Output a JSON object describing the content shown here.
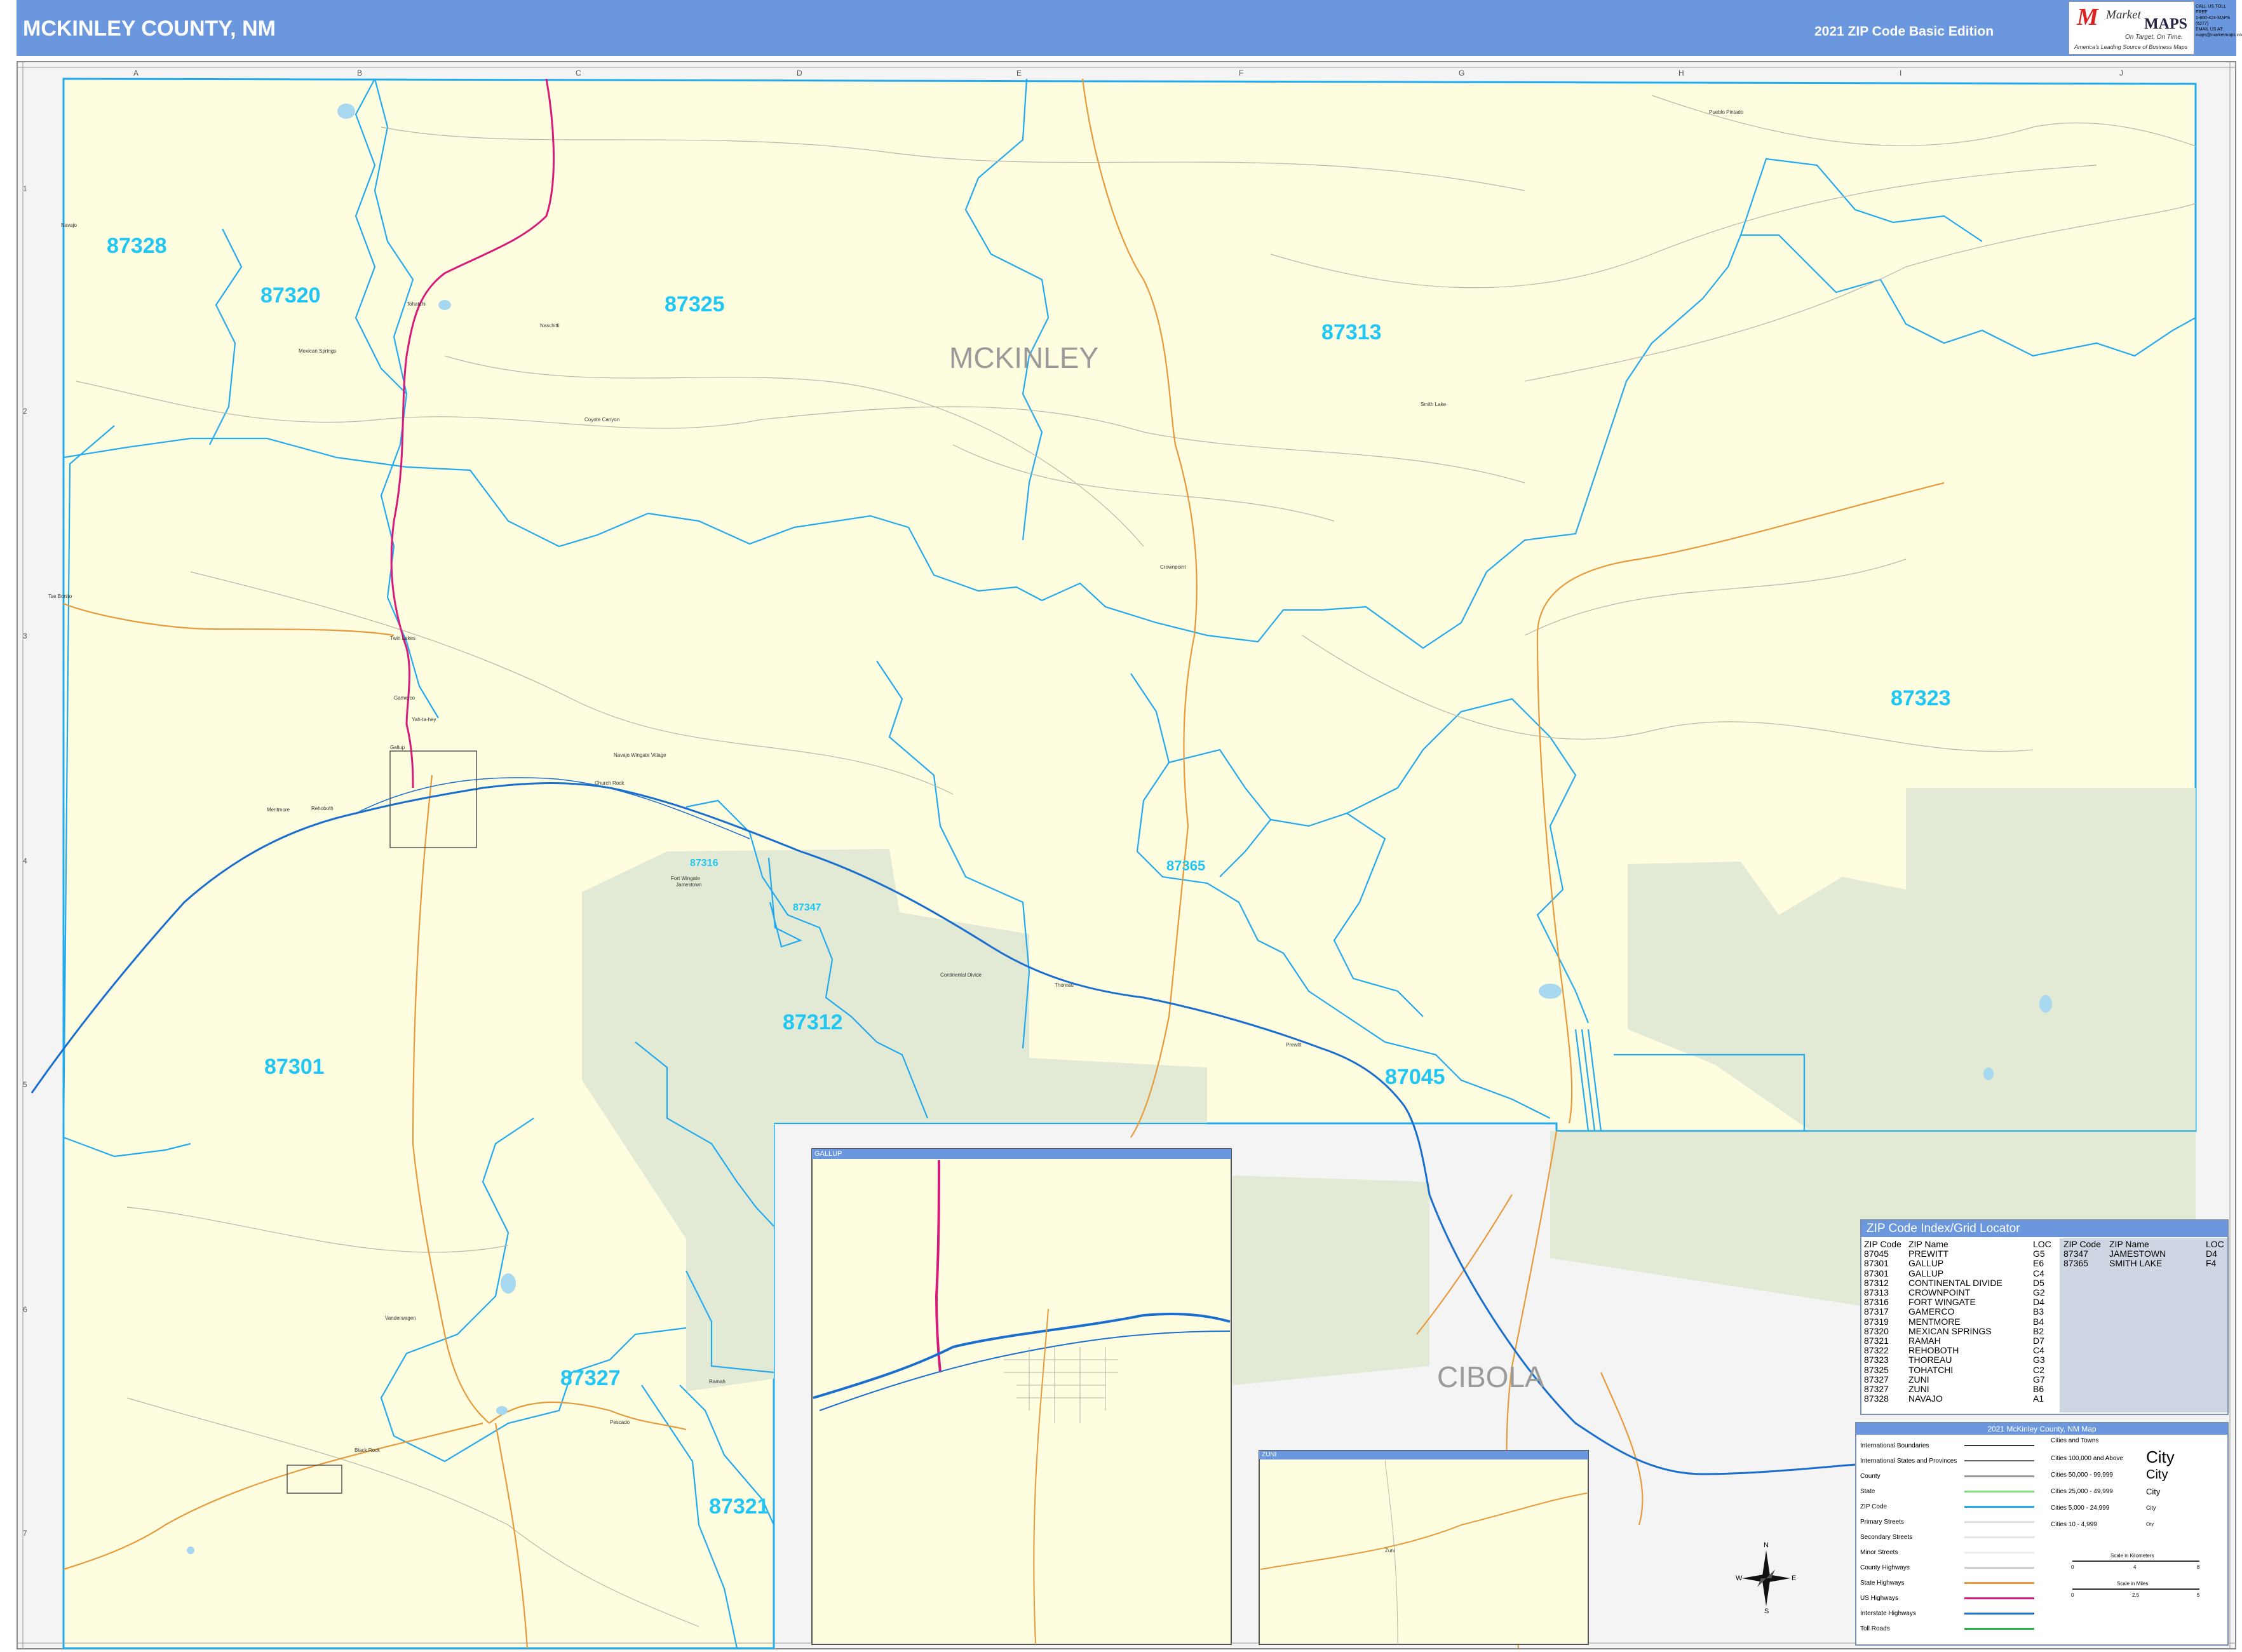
{
  "header": {
    "title": "MCKINLEY COUNTY, NM",
    "edition": "2021 ZIP Code Basic Edition"
  },
  "logo": {
    "brand_top": "Market",
    "brand_bottom": "MAPS",
    "tagline": "On Target, On Time.",
    "subtag": "America's Leading Source of Business Maps"
  },
  "contact": [
    "CALL US TOLL FREE",
    "1-800-424-MAPS (6277)",
    "EMAIL US AT:",
    "maps@marketmaps.com"
  ],
  "grid": {
    "columns": [
      "A",
      "B",
      "C",
      "D",
      "E",
      "F",
      "G",
      "H",
      "I",
      "J"
    ],
    "rows": [
      "1",
      "2",
      "3",
      "4",
      "5",
      "6",
      "7"
    ]
  },
  "county_labels": {
    "mckinley": "MCKINLEY",
    "cibola": "CIBOLA"
  },
  "zip_labels": [
    {
      "zip": "87328",
      "size": "large"
    },
    {
      "zip": "87320",
      "size": "large"
    },
    {
      "zip": "87325",
      "size": "large"
    },
    {
      "zip": "87313",
      "size": "large"
    },
    {
      "zip": "87323",
      "size": "large"
    },
    {
      "zip": "87316",
      "size": "small"
    },
    {
      "zip": "87347",
      "size": "small"
    },
    {
      "zip": "87365",
      "size": "medium"
    },
    {
      "zip": "87312",
      "size": "large"
    },
    {
      "zip": "87301",
      "size": "large"
    },
    {
      "zip": "87045",
      "size": "large"
    },
    {
      "zip": "87327",
      "size": "large"
    },
    {
      "zip": "87321",
      "size": "large"
    }
  ],
  "places": [
    "Navajo",
    "Mexican Springs",
    "Naschitti",
    "Coyote Canyon",
    "Tohatchi",
    "Twin Lakes",
    "Yah-ta-hey",
    "Gallup",
    "Church Rock",
    "Fort Wingate",
    "Navajo Wingate Village",
    "Crownpoint",
    "Smith Lake",
    "Continental Divide",
    "Thoreau",
    "Prewitt",
    "Zuni",
    "Vanderwagen",
    "Black Rock",
    "Pescado",
    "Ramah",
    "Pueblo Pintado",
    "Tse Bonito",
    "Rehoboth",
    "Gamerco",
    "Jamestown",
    "Mentmore"
  ],
  "insets": {
    "gallup": "GALLUP",
    "zuni": "ZUNI"
  },
  "zip_index": {
    "title": "ZIP Code Index/Grid Locator",
    "headers": [
      "ZIP Code",
      "ZIP Name",
      "LOC"
    ],
    "rows_left": [
      [
        "87045",
        "PREWITT",
        "G5"
      ],
      [
        "87301",
        "GALLUP",
        "E6"
      ],
      [
        "87301",
        "GALLUP",
        "C4"
      ],
      [
        "87312",
        "CONTINENTAL DIVIDE",
        "D5"
      ],
      [
        "87313",
        "CROWNPOINT",
        "G2"
      ],
      [
        "87316",
        "FORT WINGATE",
        "D4"
      ],
      [
        "87317",
        "GAMERCO",
        "B3"
      ],
      [
        "87319",
        "MENTMORE",
        "B4"
      ],
      [
        "87320",
        "MEXICAN SPRINGS",
        "B2"
      ],
      [
        "87321",
        "RAMAH",
        "D7"
      ],
      [
        "87322",
        "REHOBOTH",
        "C4"
      ],
      [
        "87323",
        "THOREAU",
        "G3"
      ],
      [
        "87325",
        "TOHATCHI",
        "C2"
      ],
      [
        "87327",
        "ZUNI",
        "G7"
      ],
      [
        "87327",
        "ZUNI",
        "B6"
      ],
      [
        "87328",
        "NAVAJO",
        "A1"
      ]
    ],
    "rows_right": [
      [
        "87347",
        "JAMESTOWN",
        "D4"
      ],
      [
        "87365",
        "SMITH LAKE",
        "F4"
      ]
    ]
  },
  "legend": {
    "title": "2021 McKinley County, NM Map",
    "left": [
      "International Boundaries",
      "International States and Provinces",
      "County",
      "State",
      "ZIP Code",
      "Primary Streets",
      "Secondary Streets",
      "Minor Streets",
      "County Highways",
      "State Highways",
      "US Highways",
      "Interstate Highways",
      "Toll Roads"
    ],
    "right": [
      {
        "label": "Cities and Towns",
        "sample": ""
      },
      {
        "label": "Cities 100,000 and Above",
        "sample": "City"
      },
      {
        "label": "Cities 50,000 - 99,999",
        "sample": "City"
      },
      {
        "label": "Cities 25,000 - 49,999",
        "sample": "City"
      },
      {
        "label": "Cities 5,000 - 24,999",
        "sample": "City"
      },
      {
        "label": "Cities 10 - 4,999",
        "sample": "City"
      }
    ],
    "scale_km": "Scale in Kilometers",
    "scale_mi": "Scale in Miles",
    "km_ticks": [
      "0",
      "4",
      "8"
    ],
    "mi_ticks": [
      "0",
      "2.5",
      "5"
    ]
  },
  "compass": {
    "n": "N",
    "s": "S",
    "e": "E",
    "w": "W"
  },
  "colors": {
    "header": "#6a97dd",
    "county_fill": "#fffde0",
    "outside_fill": "#f4f4f4",
    "forest": "#e2ead6",
    "zip_boundary": "#22aaee",
    "zip_label": "#22c6f2",
    "interstate": "#1a6fce",
    "us_highway": "#d81b7a",
    "state_highway": "#e69a3c"
  }
}
